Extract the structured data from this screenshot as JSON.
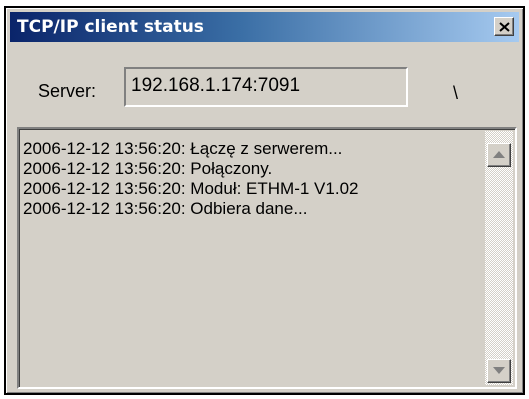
{
  "window": {
    "title": "TCP/IP client status"
  },
  "server": {
    "label": "Server:",
    "value": "192.168.1.174:7091",
    "spinner": "\\"
  },
  "log": {
    "lines": [
      "2006-12-12 13:56:20: Łączę z serwerem...",
      "2006-12-12 13:56:20: Połączony.",
      "2006-12-12 13:56:20: Moduł: ETHM-1 V1.02",
      "2006-12-12 13:56:20: Odbiera dane..."
    ]
  },
  "icons": {
    "close": "close-icon",
    "scroll_up": "arrow-up-icon",
    "scroll_down": "arrow-down-icon"
  },
  "colors": {
    "title_gradient_start": "#0a246a",
    "title_gradient_end": "#a6caf0",
    "window_face": "#d4d0c8",
    "title_text": "#ffffff"
  }
}
